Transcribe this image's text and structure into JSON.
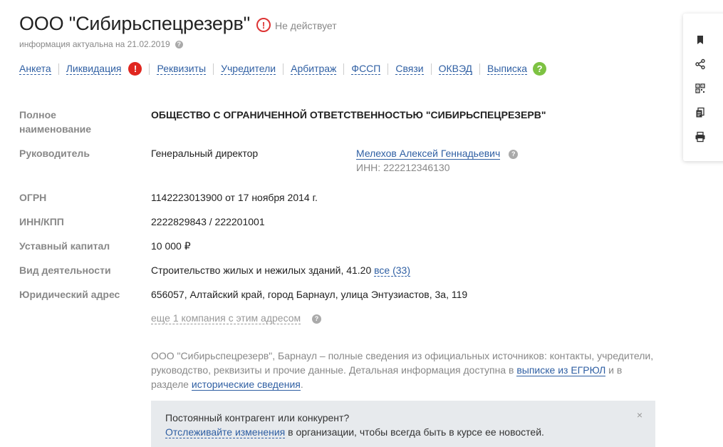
{
  "header": {
    "company_title": "ООО \"Сибирьспецрезерв\"",
    "status_text": "Не действует",
    "info_text": "информация актуальна на 21.02.2019"
  },
  "tabs": [
    {
      "label": "Анкета"
    },
    {
      "label": "Ликвидация"
    },
    {
      "label": "Реквизиты"
    },
    {
      "label": "Учредители"
    },
    {
      "label": "Арбитраж"
    },
    {
      "label": "ФССП"
    },
    {
      "label": "Связи"
    },
    {
      "label": "ОКВЭД"
    },
    {
      "label": "Выписка"
    }
  ],
  "fields": {
    "full_name_label": "Полное наименование",
    "full_name_value": "ОБЩЕСТВО С ОГРАНИЧЕННОЙ ОТВЕТСТВЕННОСТЬЮ \"СИБИРЬСПЕЦРЕЗЕРВ\"",
    "director_label": "Руководитель",
    "director_role": "Генеральный директор",
    "director_name": "Мелехов Алексей Геннадьевич",
    "director_inn": "ИНН: 222212346130",
    "ogrn_label": "ОГРН",
    "ogrn_value": "1142223013900 от 17 ноября 2014 г.",
    "inn_label": "ИНН/КПП",
    "inn_value": "2222829843 / 222201001",
    "capital_label": "Уставный капитал",
    "capital_value": "10 000 ₽",
    "activity_label": "Вид деятельности",
    "activity_value": "Строительство жилых и нежилых зданий, 41.20",
    "activity_link": "все (33)",
    "address_label": "Юридический адрес",
    "address_value": "656057, Алтайский край, город Барнаул, улица Энтузиастов, 3а, 119",
    "address_more": "еще 1 компания с этим адресом"
  },
  "description": {
    "text_1": "ООО \"Сибирьспецрезерв\", Барнаул – полные сведения из официальных источников: контакты, учредители, руководство, реквизиты и прочие данные. Детальная информация доступна в ",
    "link_1": "выписке из ЕГРЮЛ",
    "text_2": " и в разделе ",
    "link_2": "исторические сведения",
    "text_3": "."
  },
  "notice": {
    "line_1": "Постоянный контрагент или конкурент?",
    "link": "Отслеживайте изменения",
    "line_2_rest": " в организации, чтобы всегда быть в курсе ее новостей.",
    "close": "×"
  },
  "side_panel": {
    "items": [
      {
        "icon": "bookmark-icon"
      },
      {
        "icon": "share-icon"
      },
      {
        "icon": "qr-code-icon"
      },
      {
        "icon": "document-icon"
      },
      {
        "icon": "printer-icon"
      }
    ]
  },
  "colors": {
    "link": "#2f5fa3",
    "status_red": "#e0261f",
    "help_green": "#7dc242",
    "notice_bg": "#e7eaed"
  }
}
